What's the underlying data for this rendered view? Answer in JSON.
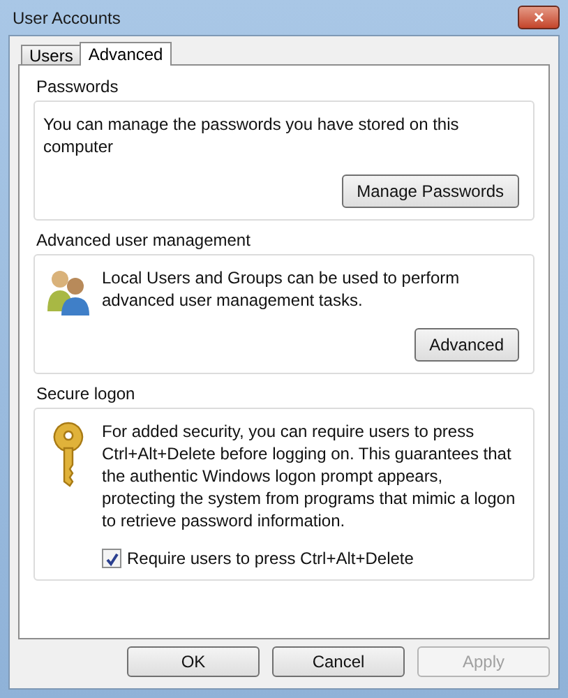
{
  "window": {
    "title": "User Accounts",
    "close": "✕"
  },
  "tabs": [
    {
      "label": "Users",
      "selected": false
    },
    {
      "label": "Advanced",
      "selected": true
    }
  ],
  "groups": [
    {
      "title": "Passwords",
      "kind": "plain",
      "text": "You can manage the passwords you have stored on this computer",
      "button": "Manage Passwords"
    },
    {
      "title": "Advanced user management",
      "kind": "users",
      "text": "Local Users and Groups can be used to perform advanced user management tasks.",
      "button": "Advanced"
    },
    {
      "title": "Secure logon",
      "kind": "key",
      "text": "For added security, you can require users to press Ctrl+Alt+Delete before logging on. This guarantees that the authentic Windows logon prompt appears, protecting the system from programs that mimic a logon to retrieve password information.",
      "checkbox": {
        "label": "Require users to press Ctrl+Alt+Delete",
        "checked": true
      }
    }
  ],
  "buttons": [
    {
      "label": "OK",
      "disabled": false
    },
    {
      "label": "Cancel",
      "disabled": false
    },
    {
      "label": "Apply",
      "disabled": true
    }
  ]
}
